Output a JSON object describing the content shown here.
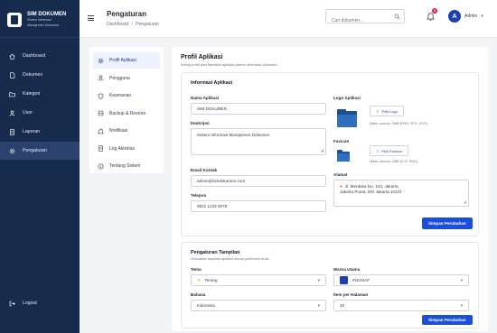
{
  "sidebar": {
    "brand_title": "SIM DOKUMEN",
    "brand_sub1": "Sistem Informasi",
    "brand_sub2": "Manajemen Dokumen",
    "items": [
      {
        "label": "Dashboard",
        "icon": "home-icon"
      },
      {
        "label": "Dokumen",
        "icon": "document-icon"
      },
      {
        "label": "Kategori",
        "icon": "folder-icon"
      },
      {
        "label": "User",
        "icon": "user-icon"
      },
      {
        "label": "Laporan",
        "icon": "report-icon"
      },
      {
        "label": "Pengaturan",
        "icon": "gear-icon"
      }
    ],
    "logout_label": "Logout"
  },
  "header": {
    "title": "Pengaturan",
    "breadcrumb_home": "Dashboard",
    "breadcrumb_sep": "›",
    "breadcrumb_current": "Pengaturan",
    "search_placeholder": "Cari dokumen...",
    "notification_count": "3",
    "user_initial": "A",
    "user_name": "Admin",
    "user_caret": "▾"
  },
  "settings_menu": {
    "items": [
      {
        "label": "Profil Aplikasi",
        "icon": "gear-icon"
      },
      {
        "label": "Pengguna",
        "icon": "user-icon"
      },
      {
        "label": "Keamanan",
        "icon": "shield-icon"
      },
      {
        "label": "Backup & Restore",
        "icon": "database-icon"
      },
      {
        "label": "Notifikasi",
        "icon": "bell-icon"
      },
      {
        "label": "Log Aktivitas",
        "icon": "log-icon"
      },
      {
        "label": "Tentang Sistem",
        "icon": "info-icon"
      }
    ]
  },
  "main": {
    "title": "Profil Aplikasi",
    "description": "Kelola profil dan identitas aplikasi sistem informasi dokumen",
    "info_card": {
      "title": "Informasi Aplikasi",
      "app_name_label": "Nama Aplikasi",
      "app_name_value": "SIM DOKUMEN",
      "description_label": "Deskripsi",
      "description_value": "Sistem Informasi Manajemen Dokumen",
      "email_label": "Email Kontak",
      "email_value": "admin@simdokumen.com",
      "phone_label": "Telepon",
      "phone_value": "0821 1234 5678",
      "logo_label": "Logo Aplikasi",
      "logo_button": "Pilih Logo",
      "logo_hint": "Maks. ukuran: 2MB (PNG, JPG, SVG)",
      "favicon_label": "Favicon",
      "favicon_button": "Pilih Favicon",
      "favicon_hint": "Maks. ukuran: 1MB (ICO, PNG)",
      "address_label": "Alamat",
      "address_line1": "Jl. Merdeka No. 123, Jakarta",
      "address_line2": "Jakarta Pusat, DKI Jakarta 10110",
      "save_label": "Simpan Perubahan"
    },
    "display_card": {
      "title": "Pengaturan Tampilan",
      "description": "Sesuaikan tampilan aplikasi sesuai preferensi Anda",
      "theme_label": "Tema",
      "theme_value": "Terang",
      "color_label": "Warna Utama",
      "color_value": "#1E40AF",
      "language_label": "Bahasa",
      "language_value": "Indonesia",
      "per_page_label": "Item per Halaman",
      "per_page_value": "10",
      "save_label": "Simpan Perubahan"
    }
  },
  "colors": {
    "sidebar": "#172b4d",
    "primary": "#1d4ed8",
    "accent": "#1e40af"
  }
}
